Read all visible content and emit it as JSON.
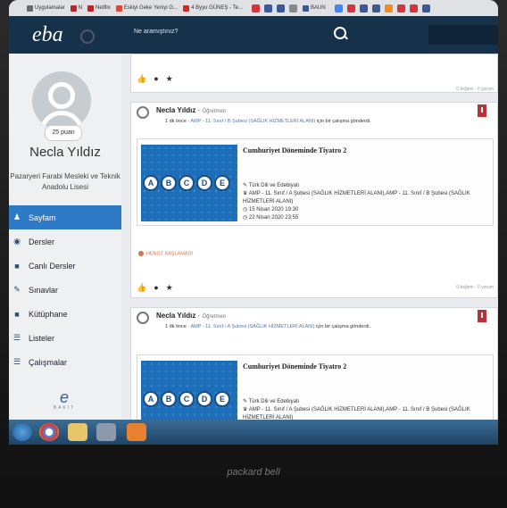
{
  "bookmarks": [
    {
      "label": "Uygulamalar",
      "color": "#6b6b6b"
    },
    {
      "label": "N",
      "color": "#b8272c"
    },
    {
      "label": "Netflix",
      "color": "#b8272c"
    },
    {
      "label": "Eskiyi Geke Yeniyi G...",
      "color": "#d34b3a"
    },
    {
      "label": "4 Byyu GÜNEŞ - Te...",
      "color": "#cc2a2a"
    },
    {
      "label": "BAUN",
      "color": "#3b5998"
    }
  ],
  "header": {
    "logo": "eba",
    "search_placeholder": "Ne aramıştınız?"
  },
  "sidebar": {
    "points": "25 puan",
    "user_name": "Necla Yıldız",
    "school": "Pazaryeri Farabi Mesleki ve Teknik Anadolu Lisesi",
    "items": [
      {
        "label": "Sayfam",
        "icon": "user-icon",
        "active": true
      },
      {
        "label": "Dersler",
        "icon": "circle-icon",
        "active": false
      },
      {
        "label": "Canlı Dersler",
        "icon": "video-icon",
        "active": false
      },
      {
        "label": "Sınavlar",
        "icon": "pencil-icon",
        "active": false
      },
      {
        "label": "Kütüphane",
        "icon": "book-icon",
        "active": false
      },
      {
        "label": "Listeler",
        "icon": "list-icon",
        "active": false
      },
      {
        "label": "Çalışmalar",
        "icon": "tasks-icon",
        "active": false
      }
    ],
    "footer_logo": "e",
    "footer_text": "BAKIT"
  },
  "feed": {
    "top_likes": "0 beğeni · 0 yorum",
    "posts": [
      {
        "author": "Necla Yıldız",
        "role": "Öğretmen",
        "time": "1 dk önce",
        "target": "AMP - 11. Sınıf / B Şubesi (SAĞLIK HİZMETLERİ ALANI)",
        "action": "için bir çalışma gönderdi.",
        "assignment_title": "Cumhuriyet Döneminde Tiyatro 2",
        "subject": "Türk Dili ve Edebiyatı",
        "classes": "AMP - 11. Sınıf / A Şubesi (SAĞLIK HİZMETLERİ ALANI),AMP - 11. Sınıf / B Şubesi (SAĞLIK HİZMETLERİ ALANI)",
        "start": "15 Nisan 2020 19:30",
        "end": "22 Nisan 2020 23:55",
        "status": "HENÜZ BAŞLAMADI",
        "likes": "0 beğeni · 0 yorum"
      },
      {
        "author": "Necla Yıldız",
        "role": "Öğretmen",
        "time": "1 dk önce",
        "target": "AMP - 11. Sınıf / A Şubesi (SAĞLIK HİZMETLERİ ALANI)",
        "action": "için bir çalışma gönderdi.",
        "assignment_title": "Cumhuriyet Döneminde Tiyatro 2",
        "subject": "Türk Dili ve Edebiyatı",
        "classes": "AMP - 11. Sınıf / A Şubesi (SAĞLIK HİZMETLERİ ALANI),AMP - 11. Sınıf / B Şubesi (SAĞLIK HİZMETLERİ ALANI)"
      }
    ]
  },
  "thumbnail_letters": [
    "A",
    "B",
    "C",
    "D",
    "E"
  ],
  "brand": "packard bell"
}
